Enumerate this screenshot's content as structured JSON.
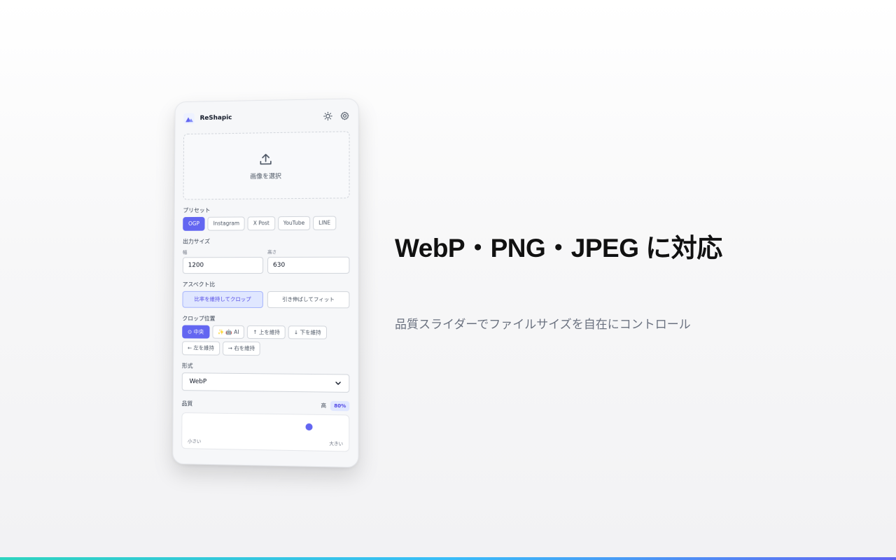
{
  "app": {
    "name": "ReShapic",
    "icons": [
      "image-logo-icon",
      "sun-icon",
      "gear-icon",
      "upload-icon"
    ]
  },
  "upload": {
    "label": "画像を選択"
  },
  "presets": {
    "label": "プリセット",
    "items": [
      "OGP",
      "Instagram",
      "X Post",
      "YouTube",
      "LINE"
    ],
    "active": "OGP"
  },
  "output_size": {
    "label": "出力サイズ",
    "width_label": "幅",
    "width_value": "1200",
    "height_label": "高さ",
    "height_value": "630"
  },
  "aspect": {
    "label": "アスペクト比",
    "options": [
      "比率を維持してクロップ",
      "引き伸ばしてフィット"
    ],
    "active": "比率を維持してクロップ"
  },
  "crop_position": {
    "label": "クロップ位置",
    "options": [
      "⊙ 中央",
      "✨ 🤖 AI",
      "↑ 上を維持",
      "↓ 下を維持",
      "← 左を維持",
      "→ 右を維持"
    ],
    "active": "⊙ 中央"
  },
  "format": {
    "label": "形式",
    "value": "WebP"
  },
  "quality": {
    "label": "品質",
    "level_text": "高",
    "value_text": "80%",
    "value": 0.8,
    "min_label": "小さい",
    "max_label": "大きい"
  },
  "hero": {
    "title": "WebP・PNG・JPEG に対応",
    "subtitle": "品質スライダーでファイルサイズを自在にコントロール"
  },
  "colors": {
    "accent": "#6366f1",
    "accent_light": "#e0e7ff",
    "bottom_bar": [
      "#2dd4bf",
      "#38bdf8",
      "#6366f1"
    ]
  }
}
